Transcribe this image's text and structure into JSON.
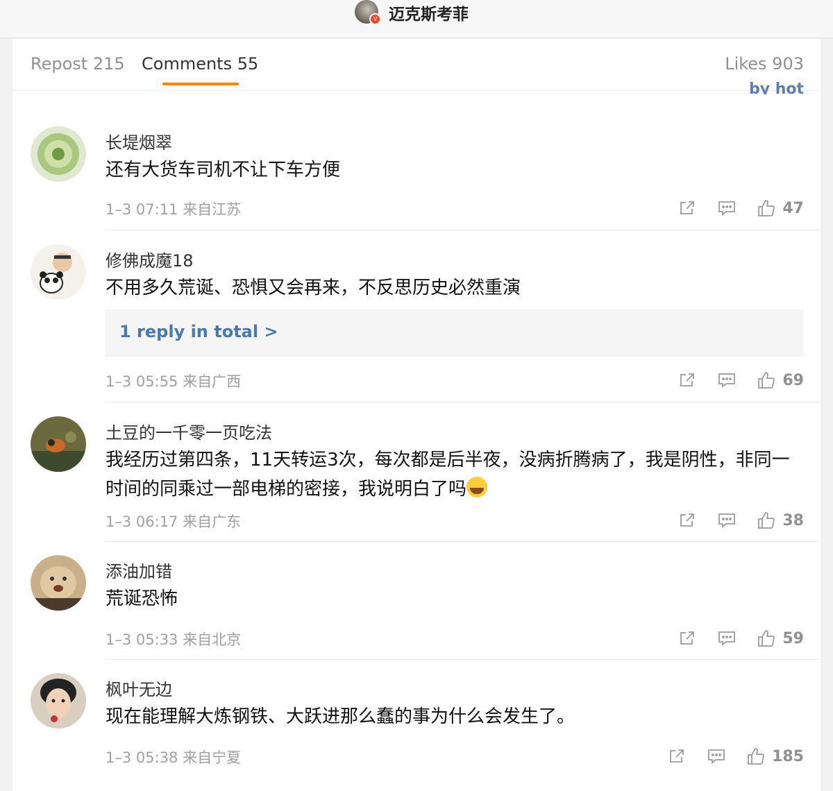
{
  "header": {
    "author_name": "迈克斯考菲"
  },
  "tabs": {
    "repost": "Repost 215",
    "comments": "Comments 55",
    "likes": "Likes 903",
    "sort_partial": "by hot"
  },
  "comments": [
    {
      "user": "长堤烟翠",
      "text": "还有大货车司机不让下车方便",
      "meta": "1–3 07:11 来自江苏",
      "likes": "47"
    },
    {
      "user": "修佛成魔18",
      "text": "不用多久荒诞、恐惧又会再来，不反思历史必然重演",
      "reply_link": "1 reply in total >",
      "meta": "1–3 05:55 来自广西",
      "likes": "69"
    },
    {
      "user": "土豆的一千零一页吃法",
      "text": "我经历过第四条，11天转运3次，每次都是后半夜，没病折腾病了，我是阴性，非同一时间的同乘过一部电梯的密接，我说明白了吗",
      "meta": "1–3 06:17 来自广东",
      "likes": "38"
    },
    {
      "user": "添油加错",
      "text": "荒诞恐怖",
      "meta": "1–3 05:33 来自北京",
      "likes": "59"
    },
    {
      "user": "枫叶无边",
      "text": "现在能理解大炼钢铁、大跃进那么蠢的事为什么会发生了。",
      "meta": "1–3 05:38 来自宁夏",
      "likes": "185"
    }
  ],
  "icons": {
    "share": "share-icon",
    "reply": "comment-icon",
    "like": "thumbs-up-icon",
    "emoji": "laughing-crying-emoji"
  },
  "colors": {
    "accent": "#f7860f",
    "link": "#4a78b2"
  }
}
